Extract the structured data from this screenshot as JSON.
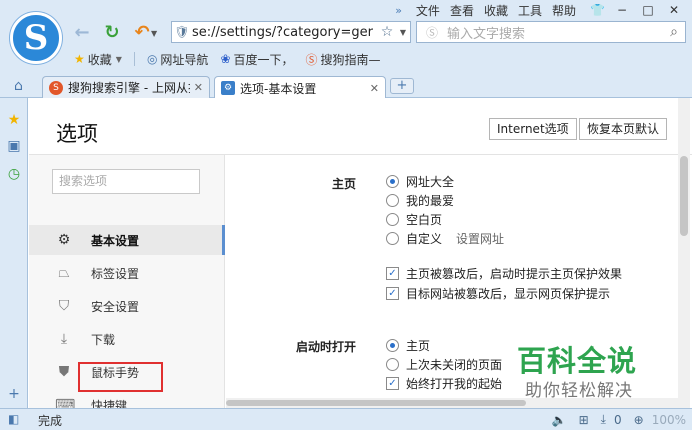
{
  "menubar": {
    "items": [
      "文件",
      "查看",
      "收藏",
      "工具",
      "帮助"
    ]
  },
  "address": {
    "url": "se://settings/?category=ger"
  },
  "search": {
    "placeholder": "输入文字搜索"
  },
  "bookmarks": {
    "items": [
      "收藏",
      "网址导航",
      "百度一下，",
      "搜狗指南—"
    ]
  },
  "tabs": [
    {
      "label": "搜狗搜索引擎 - 上网从搜"
    },
    {
      "label": "选项-基本设置"
    }
  ],
  "page": {
    "title": "选项",
    "btn_internet": "Internet选项",
    "btn_restore": "恢复本页默认"
  },
  "sidebar": {
    "search_placeholder": "搜索选项",
    "items": [
      {
        "label": "基本设置",
        "icon": "gear-icon"
      },
      {
        "label": "标签设置",
        "icon": "tab-icon"
      },
      {
        "label": "安全设置",
        "icon": "shield-check-icon"
      },
      {
        "label": "下载",
        "icon": "download-icon"
      },
      {
        "label": "鼠标手势",
        "icon": "mouse-icon"
      },
      {
        "label": "快捷键",
        "icon": "keyboard-icon"
      }
    ]
  },
  "homepage": {
    "label": "主页",
    "options": [
      "网址大全",
      "我的最爱",
      "空白页",
      "自定义"
    ],
    "custom_link": "设置网址",
    "checks": [
      "主页被篡改后，启动时提示主页保护效果",
      "目标网站被篡改后，显示网页保护提示"
    ]
  },
  "startup": {
    "label": "启动时打开",
    "options": [
      "主页",
      "上次未关闭的页面"
    ],
    "check": "始终打开我的起始"
  },
  "watermark": {
    "big": "百科全说",
    "small": "助你轻松解决"
  },
  "status": {
    "text": "完成",
    "count": "0",
    "zoom": "100%"
  },
  "colors": {
    "frame": "#dce9f6",
    "accent": "#2a6fc9",
    "highlight_box": "#e03030",
    "watermark_green": "#2ea44f"
  }
}
